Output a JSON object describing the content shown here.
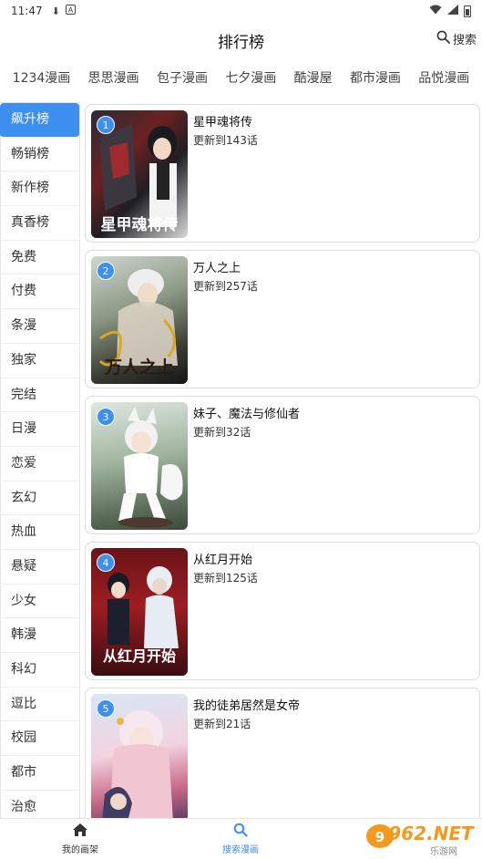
{
  "status_bar": {
    "time": "11:47",
    "icons": [
      "download-icon",
      "a-badge-icon",
      "wifi-icon",
      "signal-icon",
      "battery-icon"
    ]
  },
  "header": {
    "title": "排行榜",
    "search_label": "搜索"
  },
  "sources": [
    "1234漫画",
    "思思漫画",
    "包子漫画",
    "七夕漫画",
    "酷漫屋",
    "都市漫画",
    "品悦漫画"
  ],
  "categories": [
    "飙升榜",
    "畅销榜",
    "新作榜",
    "真香榜",
    "免费",
    "付费",
    "条漫",
    "独家",
    "完结",
    "日漫",
    "恋爱",
    "玄幻",
    "热血",
    "悬疑",
    "少女",
    "韩漫",
    "科幻",
    "逗比",
    "校园",
    "都市",
    "治愈"
  ],
  "active_category": "飙升榜",
  "comics": [
    {
      "rank": "1",
      "title": "星甲魂将传",
      "update": "更新到143话",
      "cover_text": "星甲魂将传"
    },
    {
      "rank": "2",
      "title": "万人之上",
      "update": "更新到257话",
      "cover_text": "万人之上"
    },
    {
      "rank": "3",
      "title": "妹子、魔法与修仙者",
      "update": "更新到32话",
      "cover_text": ""
    },
    {
      "rank": "4",
      "title": "从红月开始",
      "update": "更新到125话",
      "cover_text": "从红月开始"
    },
    {
      "rank": "5",
      "title": "我的徒弟居然是女帝",
      "update": "更新到21话",
      "cover_text": ""
    }
  ],
  "bottom_nav": {
    "tab1": "我的画架",
    "tab2": "搜索漫画"
  },
  "watermark": {
    "text": "962.NET",
    "sub": "乐游网"
  },
  "colors": {
    "accent": "#3d8ff0",
    "border": "#dcdcdc"
  }
}
